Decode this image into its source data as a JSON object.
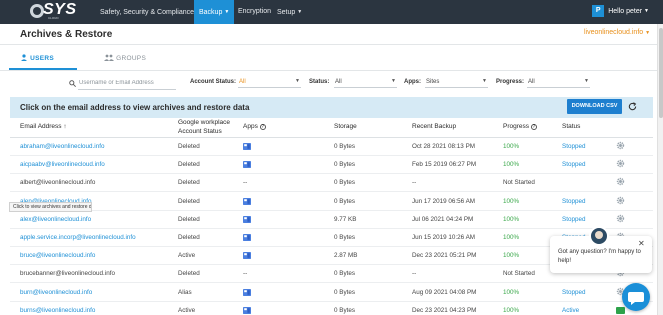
{
  "nav": {
    "logo_text": "SYS",
    "logo_sub": "CLOUD",
    "items": [
      {
        "label": "Safety, Security & Compliance",
        "has_caret": true
      },
      {
        "label": "Backup",
        "has_caret": true,
        "active": true
      },
      {
        "label": "Encryption",
        "has_caret": false
      },
      {
        "label": "Setup",
        "has_caret": true
      }
    ],
    "user_initial": "P",
    "user_greeting": "Hello peter"
  },
  "header": {
    "title": "Archives & Restore",
    "domain": "liveonlinecloud.info"
  },
  "tabs": [
    {
      "label": "USERS",
      "active": true,
      "icon": "user-icon"
    },
    {
      "label": "GROUPS",
      "active": false,
      "icon": "group-icon"
    }
  ],
  "filters": {
    "search_placeholder": "Username or Email Address",
    "account_status_label": "Account Status:",
    "account_status_value": "All",
    "status_label": "Status:",
    "status_value": "All",
    "apps_label": "Apps:",
    "apps_value": "Sites",
    "progress_label": "Progress:",
    "progress_value": "All"
  },
  "infobar": {
    "text": "Click on the email address to view archives and restore data",
    "download_label": "DOWNLOAD CSV"
  },
  "table": {
    "headers": {
      "email": "Email Address",
      "workplace_1": "Google workplace",
      "workplace_2": "Account Status",
      "apps": "Apps",
      "storage": "Storage",
      "backup": "Recent Backup",
      "progress": "Progress",
      "status": "Status"
    },
    "rows": [
      {
        "email": "abraham@liveonlinecloud.info",
        "link": true,
        "account": "Deleted",
        "apps": "icon",
        "storage": "0 Bytes",
        "backup": "Oct 28 2021 08:13 PM",
        "progress": "100%",
        "status": "Stopped"
      },
      {
        "email": "aicpaabv@liveonlinecloud.info",
        "link": true,
        "account": "Deleted",
        "apps": "icon",
        "storage": "0 Bytes",
        "backup": "Feb 15 2019 06:27 PM",
        "progress": "100%",
        "status": "Stopped"
      },
      {
        "email": "albert@liveonlinecloud.info",
        "link": false,
        "account": "Deleted",
        "apps": "--",
        "storage": "0 Bytes",
        "backup": "--",
        "progress": "Not Started",
        "status": ""
      },
      {
        "email": "alen@liveonlinecloud.info",
        "link": true,
        "account": "Deleted",
        "apps": "icon",
        "storage": "0 Bytes",
        "backup": "Jun 17 2019 06:56 AM",
        "progress": "100%",
        "status": "Stopped"
      },
      {
        "email": "alex@liveonlinecloud.info",
        "link": true,
        "account": "Deleted",
        "apps": "icon",
        "storage": "9.77 KB",
        "backup": "Jul 06 2021 04:24 PM",
        "progress": "100%",
        "status": "Stopped"
      },
      {
        "email": "apple.service.incorp@liveonlinecloud.info",
        "link": true,
        "account": "Deleted",
        "apps": "icon",
        "storage": "0 Bytes",
        "backup": "Jun 15 2019 10:26 AM",
        "progress": "100%",
        "status": "Stopped"
      },
      {
        "email": "bruce@liveonlinecloud.info",
        "link": true,
        "account": "Active",
        "apps": "icon",
        "storage": "2.87 MB",
        "backup": "Dec 23 2021 05:21 PM",
        "progress": "100%",
        "status": ""
      },
      {
        "email": "brucebanner@liveonlinecloud.info",
        "link": false,
        "account": "Deleted",
        "apps": "--",
        "storage": "0 Bytes",
        "backup": "--",
        "progress": "Not Started",
        "status": ""
      },
      {
        "email": "burn@liveonlinecloud.info",
        "link": true,
        "account": "Alias",
        "apps": "icon",
        "storage": "0 Bytes",
        "backup": "Aug 09 2021 04:08 PM",
        "progress": "100%",
        "status": "Stopped"
      },
      {
        "email": "burns@liveonlinecloud.info",
        "link": true,
        "account": "Active",
        "apps": "icon",
        "storage": "0 Bytes",
        "backup": "Dec 23 2021 04:23 PM",
        "progress": "100%",
        "status": "Active"
      }
    ]
  },
  "tooltip": "Click to view archives and restore data",
  "chat": {
    "message": "Got any question? I'm happy to help!"
  },
  "colors": {
    "nav_bg": "#2b3540",
    "accent": "#1e90d6",
    "orange": "#e8901c",
    "green": "#3aa84a"
  }
}
